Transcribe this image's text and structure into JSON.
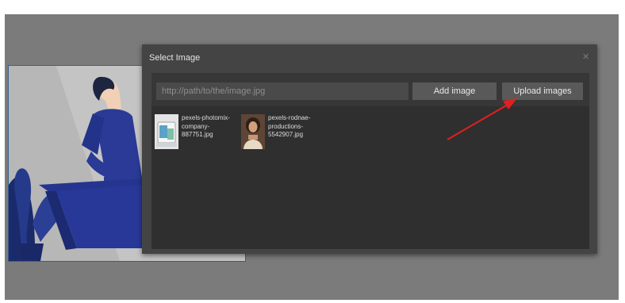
{
  "modal": {
    "title": "Select Image",
    "close_glyph": "×",
    "close_icon": "close-icon"
  },
  "url_input": {
    "placeholder": "http://path/to/the/image.jpg",
    "value": ""
  },
  "buttons": {
    "add_label": "Add image",
    "upload_label": "Upload images"
  },
  "assets": [
    {
      "name": "pexels-photomix-company-887751.jpg",
      "lines": [
        "pexels-photomix-",
        "company-",
        "887751.jpg"
      ]
    },
    {
      "name": "pexels-rodnae-productions-5542907.jpg",
      "lines": [
        "pexels-rodnae-",
        "productions-",
        "5542907.jpg"
      ]
    }
  ],
  "annotation": {
    "arrow_color": "#e02020"
  },
  "colors": {
    "modal_bg": "#444444",
    "button_bg": "#595959",
    "illustration_blue": "#1f2d78"
  }
}
